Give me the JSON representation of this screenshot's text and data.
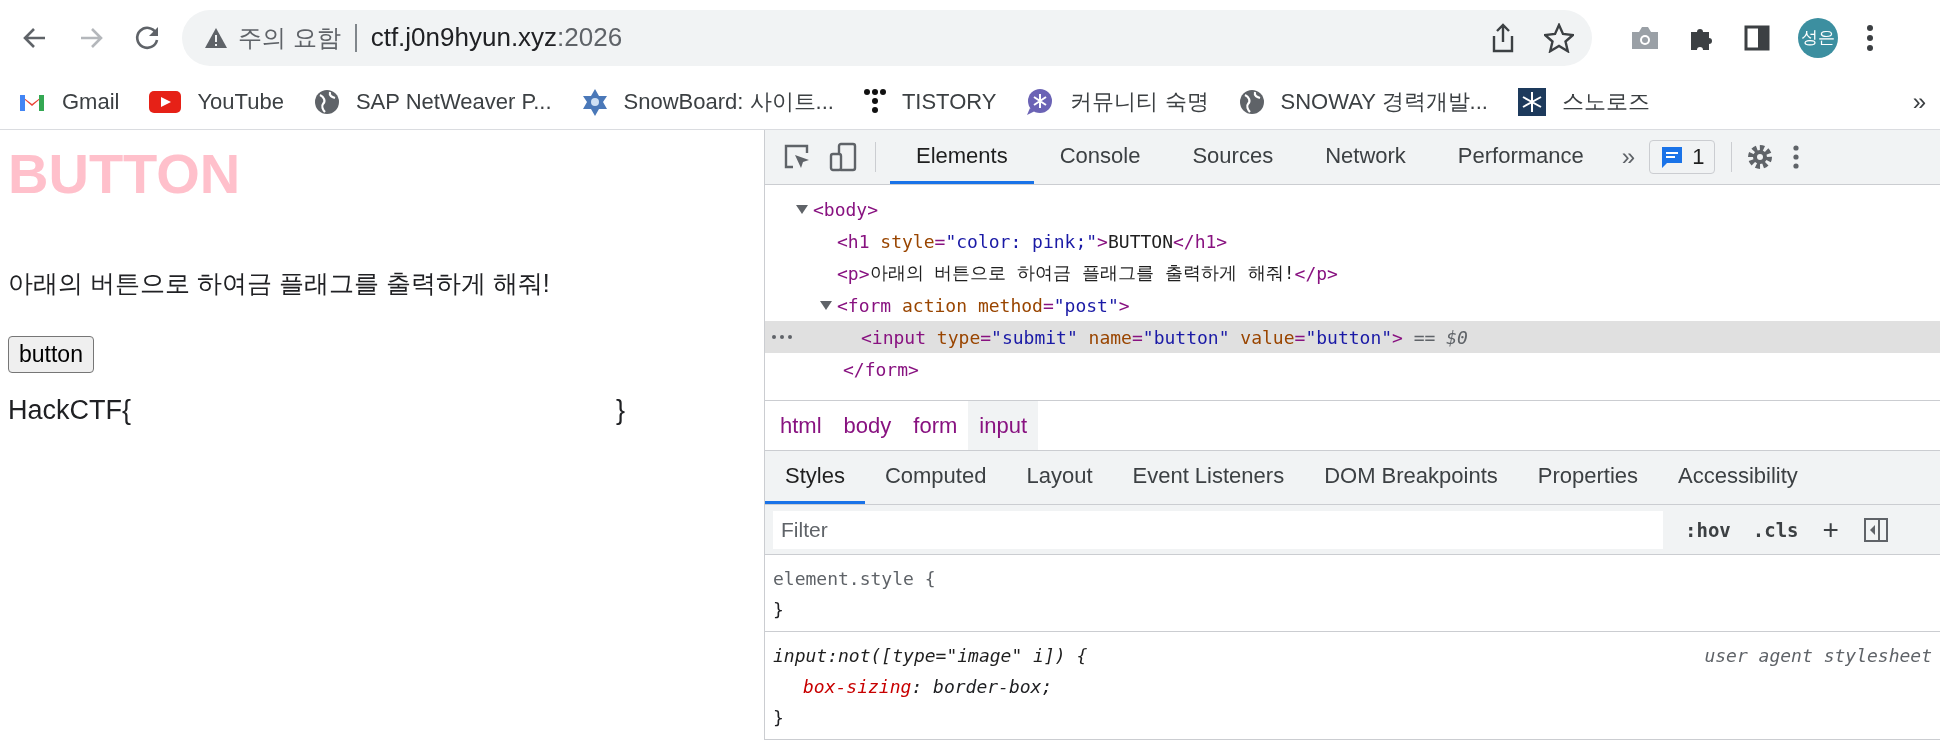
{
  "browser": {
    "nav": [
      {
        "kind": "back",
        "disabled": false
      },
      {
        "kind": "forward",
        "disabled": true
      },
      {
        "kind": "reload",
        "disabled": false
      }
    ],
    "address": {
      "security": "주의 요함",
      "host": "ctf.j0n9hyun.xyz",
      "port": ":2026"
    },
    "profile": "성은",
    "bookmarks": [
      {
        "kind": "gmail",
        "label": "Gmail"
      },
      {
        "kind": "youtube",
        "label": "YouTube"
      },
      {
        "kind": "globe",
        "label": "SAP NetWeaver P..."
      },
      {
        "kind": "star",
        "label": "SnowBoard: 사이트..."
      },
      {
        "kind": "dots",
        "label": "TISTORY"
      },
      {
        "kind": "bubble",
        "label": "커뮤니티 숙명"
      },
      {
        "kind": "globe",
        "label": "SNOWAY 경력개발..."
      },
      {
        "kind": "snowflake",
        "label": "스노로즈"
      }
    ],
    "bookmarks_more": "»"
  },
  "page": {
    "heading": "BUTTON",
    "paragraph": "아래의 버튼으로 하여금 플래그를 출력하게 해줘!",
    "button": "button",
    "flag_prefix": "HackCTF{",
    "flag_suffix": "}"
  },
  "devtools": {
    "tabs": [
      {
        "label": "Elements",
        "selected": true
      },
      {
        "label": "Console",
        "selected": false
      },
      {
        "label": "Sources",
        "selected": false
      },
      {
        "label": "Network",
        "selected": false
      },
      {
        "label": "Performance",
        "selected": false
      }
    ],
    "tabs_more": "»",
    "issues": "1",
    "dom": [
      {
        "expanded": true,
        "selected": false,
        "tokens": [
          {
            "kind": "tag",
            "t": "<body>"
          }
        ],
        "children": [
          {
            "selected": false,
            "tokens": [
              {
                "kind": "tag",
                "t": "<h1"
              },
              {
                "kind": "attr",
                "t": " style"
              },
              {
                "kind": "tag",
                "t": "="
              },
              {
                "kind": "val",
                "t": "\"color: pink;\""
              },
              {
                "kind": "tag",
                "t": ">"
              },
              {
                "kind": "text",
                "t": "BUTTON"
              },
              {
                "kind": "tag",
                "t": "</h1>"
              }
            ]
          },
          {
            "selected": false,
            "tokens": [
              {
                "kind": "tag",
                "t": "<p>"
              },
              {
                "kind": "text",
                "t": "아래의 버튼으로 하여금 플래그를 출력하게 해줘!"
              },
              {
                "kind": "tag",
                "t": "</p>"
              }
            ]
          },
          {
            "expanded": true,
            "selected": false,
            "tokens": [
              {
                "kind": "tag",
                "t": "<form"
              },
              {
                "kind": "attr",
                "t": " action method"
              },
              {
                "kind": "tag",
                "t": "="
              },
              {
                "kind": "val",
                "t": "\"post\""
              },
              {
                "kind": "tag",
                "t": ">"
              }
            ],
            "children": [
              {
                "selected": true,
                "tokens": [
                  {
                    "kind": "tag",
                    "t": "<input"
                  },
                  {
                    "kind": "attr",
                    "t": " type"
                  },
                  {
                    "kind": "tag",
                    "t": "="
                  },
                  {
                    "kind": "val",
                    "t": "\"submit\""
                  },
                  {
                    "kind": "attr",
                    "t": " name"
                  },
                  {
                    "kind": "tag",
                    "t": "="
                  },
                  {
                    "kind": "val",
                    "t": "\"button\""
                  },
                  {
                    "kind": "attr",
                    "t": " value"
                  },
                  {
                    "kind": "tag",
                    "t": "="
                  },
                  {
                    "kind": "val",
                    "t": "\"button\""
                  },
                  {
                    "kind": "tag",
                    "t": ">"
                  }
                ],
                "marker": "== $0"
              }
            ],
            "closing": [
              {
                "kind": "tag",
                "t": "</form>"
              }
            ]
          }
        ]
      }
    ],
    "breadcrumbs": [
      {
        "label": "html",
        "selected": false
      },
      {
        "label": "body",
        "selected": false
      },
      {
        "label": "form",
        "selected": false
      },
      {
        "label": "input",
        "selected": true
      }
    ],
    "style_tabs": [
      {
        "label": "Styles",
        "selected": true
      },
      {
        "label": "Computed",
        "selected": false
      },
      {
        "label": "Layout",
        "selected": false
      },
      {
        "label": "Event Listeners",
        "selected": false
      },
      {
        "label": "DOM Breakpoints",
        "selected": false
      },
      {
        "label": "Properties",
        "selected": false
      },
      {
        "label": "Accessibility",
        "selected": false
      }
    ],
    "filter": {
      "placeholder": "Filter",
      "hov": ":hov",
      "cls": ".cls",
      "add": "+"
    },
    "rules": [
      {
        "kind": "inline",
        "selector": "element.style {",
        "close": "}"
      },
      {
        "kind": "user-agent",
        "selector": "input:not([type=\"image\" i]) {",
        "source": "user agent stylesheet",
        "close": "}",
        "declarations": [
          {
            "prop": "box-sizing",
            "value": ": border-box;"
          }
        ]
      }
    ]
  }
}
